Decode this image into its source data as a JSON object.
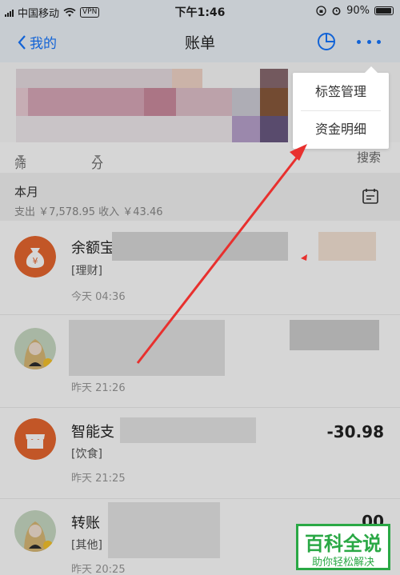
{
  "status_bar": {
    "carrier": "中国移动",
    "vpn": "VPN",
    "time": "下午1:46",
    "battery": "90%"
  },
  "nav": {
    "back_label": "我的",
    "title": "账单",
    "accent": "#1677ff"
  },
  "filter": {
    "filter_label": "筛选",
    "category_label": "分类",
    "search_label": "搜索"
  },
  "month": {
    "title": "本月",
    "summary": "支出 ￥7,578.95   收入 ￥43.46"
  },
  "transactions": [
    {
      "name": "余额宝",
      "tag": "[理财]",
      "time": "今天 04:36",
      "amount": "",
      "icon": "money-bag-icon"
    },
    {
      "name": "",
      "tag": "",
      "time": "昨天 21:26",
      "amount": "",
      "icon": "user-avatar-icon"
    },
    {
      "name": "智能支",
      "tag": "[饮食]",
      "time": "昨天 21:25",
      "amount": "-30.98",
      "icon": "store-icon"
    },
    {
      "name": "转账",
      "tag": "[其他]",
      "time": "昨天 20:25",
      "amount": "00",
      "icon": "user-avatar-icon"
    }
  ],
  "dropdown": {
    "items": [
      "标签管理",
      "资金明细"
    ]
  },
  "watermark": {
    "title": "百科全说",
    "subtitle": "助你轻松解决"
  }
}
